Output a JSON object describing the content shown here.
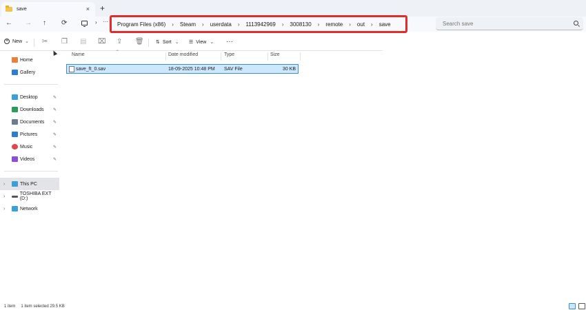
{
  "tab": {
    "title": "save",
    "close": "×",
    "new_tab": "+"
  },
  "nav": {
    "back": "←",
    "forward": "→",
    "up": "↑",
    "refresh": "⟳",
    "more": "···",
    "chevron": "›"
  },
  "breadcrumb": [
    "Program Files (x86)",
    "Steam",
    "userdata",
    "1113942969",
    "3008130",
    "remote",
    "out",
    "save"
  ],
  "search": {
    "placeholder": "Search save"
  },
  "toolbar": {
    "new_label": "New",
    "sort_label": "Sort",
    "view_label": "View",
    "more_label": "···",
    "dropdown": "⌄"
  },
  "sidebar": {
    "quick": [
      {
        "label": "Home",
        "icon": "home-icon",
        "color": "#e8803a"
      },
      {
        "label": "Gallery",
        "icon": "gallery-icon",
        "color": "#2d7dd2"
      }
    ],
    "pinned": [
      {
        "label": "Desktop",
        "icon": "desktop-icon",
        "color": "#3aa0d8"
      },
      {
        "label": "Downloads",
        "icon": "downloads-icon",
        "color": "#2a9d5c"
      },
      {
        "label": "Documents",
        "icon": "documents-icon",
        "color": "#6b7c8f"
      },
      {
        "label": "Pictures",
        "icon": "pictures-icon",
        "color": "#2d7dd2"
      },
      {
        "label": "Music",
        "icon": "music-icon",
        "color": "#e0474c"
      },
      {
        "label": "Videos",
        "icon": "videos-icon",
        "color": "#8a4fd8"
      }
    ],
    "locations": [
      {
        "label": "This PC",
        "icon": "this-pc-icon",
        "color": "#3aa0d8"
      },
      {
        "label": "TOSHIBA EXT (D:)",
        "icon": "drive-icon",
        "color": "#555555"
      },
      {
        "label": "Network",
        "icon": "network-icon",
        "color": "#3aa0d8"
      }
    ],
    "pin_glyph": "📌",
    "expander_glyph": "›"
  },
  "columns": {
    "name": "Name",
    "date": "Date modified",
    "type": "Type",
    "size": "Size"
  },
  "files": [
    {
      "name": "save_ft_0.sav",
      "date": "18-09-2025 10:48 PM",
      "type": "SAV File",
      "size": "30 KB"
    }
  ],
  "status": {
    "items": "1 item",
    "selected": "1 item selected  29.5 KB"
  },
  "colors": {
    "highlight_border": "#e22b2b",
    "selection": "#cce8ff",
    "selection_border": "#3a8ed8"
  }
}
